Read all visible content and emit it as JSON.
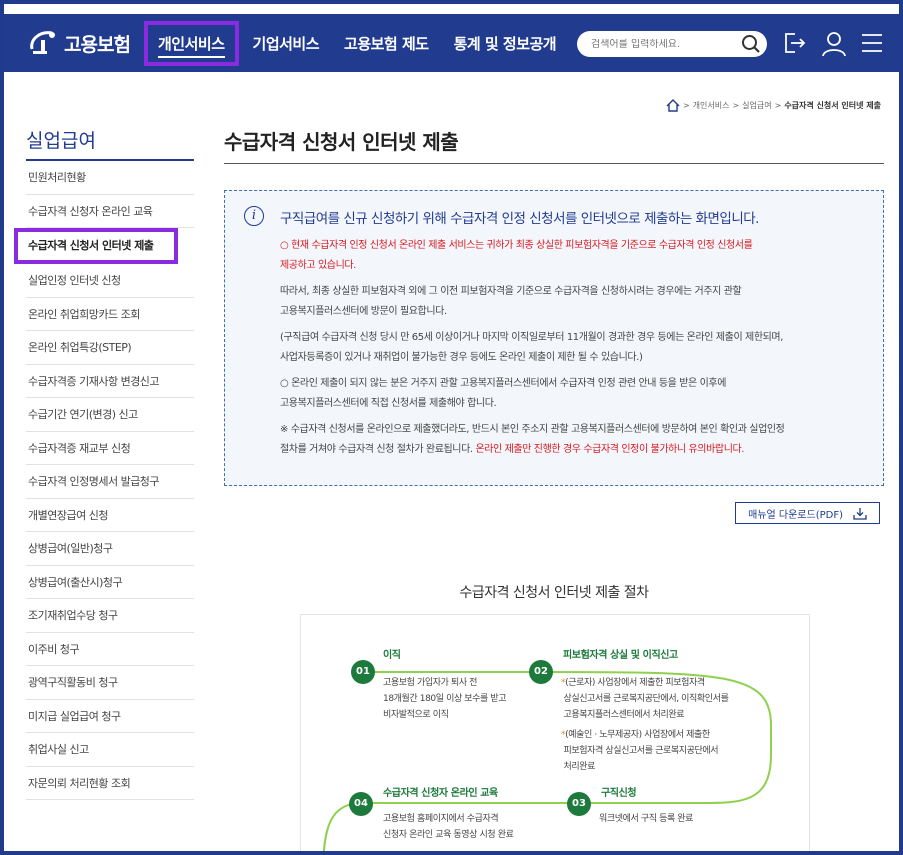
{
  "header": {
    "logo_text": "고용보험",
    "nav": [
      {
        "label": "개인서비스",
        "active": true
      },
      {
        "label": "기업서비스"
      },
      {
        "label": "고용보험 제도"
      },
      {
        "label": "통계 및 정보공개"
      }
    ],
    "search_placeholder": "검색어를 입력하세요.",
    "icons": [
      "search-icon",
      "logout-icon",
      "user-icon",
      "menu-icon"
    ]
  },
  "breadcrumb": {
    "items": [
      "개인서비스",
      "실업급여",
      "수급자격 신청서 인터넷 제출"
    ]
  },
  "sidebar": {
    "title": "실업급여",
    "items": [
      {
        "label": "민원처리현황"
      },
      {
        "label": "수급자격 신청자 온라인 교육"
      },
      {
        "label": "수급자격 신청서 인터넷 제출",
        "active": true
      },
      {
        "label": "실업인정 인터넷 신청"
      },
      {
        "label": "온라인 취업희망카드 조회"
      },
      {
        "label": "온라인 취업특강(STEP)"
      },
      {
        "label": "수급자격증 기재사항 변경신고"
      },
      {
        "label": "수급기간 연기(변경) 신고"
      },
      {
        "label": "수급자격증 재교부 신청"
      },
      {
        "label": "수급자격 인정명세서 발급청구"
      },
      {
        "label": "개별연장급여 신청"
      },
      {
        "label": "상병급여(일반)청구"
      },
      {
        "label": "상병급여(출산시)청구"
      },
      {
        "label": "조기재취업수당 청구"
      },
      {
        "label": "이주비 청구"
      },
      {
        "label": "광역구직활동비 청구"
      },
      {
        "label": "미지급 실업급여 청구"
      },
      {
        "label": "취업사실 신고"
      },
      {
        "label": "자문의뢰 처리현황 조회"
      }
    ]
  },
  "main": {
    "title": "수급자격 신청서 인터넷 제출",
    "info": {
      "heading": "구직급여를 신규 신청하기 위해 수급자격 인정 신청서를 인터넷으로 제출하는 화면입니다.",
      "p1_line1": "○ 현재 수급자격 인정 신청서 온라인 제출 서비스는 귀하가 최종 상실한 피보험자격을 기준으로 수급자격 인정 신청서를",
      "p1_line2": "제공하고 있습니다.",
      "p2_line1": "따라서, 최종 상실한 피보험자격 외에 그 이전 피보험자격을 기준으로 수급자격을 신청하시려는 경우에는 거주지 관할",
      "p2_line2": "고용복지플러스센터에 방문이 필요합니다.",
      "p3_line1": "(구직급여 수급자격 신청 당시 만 65세 이상이거나 마지막 이직일로부터 11개월이 경과한 경우 등에는 온라인 제출이 제한되며,",
      "p3_line2": "사업자등록증이 있거나 재취업이 불가능한 경우 등에도 온라인 제출이 제한 될 수 있습니다.)",
      "p4_line1": "○ 온라인 제출이 되지 않는 분은 거주지 관할 고용복지플러스센터에서 수급자격 인정 관련 안내 등을 받은 이후에",
      "p4_line2": "고용복지플러스센터에 직접 신청서를 제출해야 합니다.",
      "p5_line1": "※ 수급자격 신청서를 온라인으로 제출했더라도, 반드시 본인 주소지 관할 고용복지플러스센터에 방문하여 본인 확인과 실업인정",
      "p5_line2_a": "절차를 거쳐야 수급자격 신청 절차가 완료됩니다. ",
      "p5_line2_b": "온라인 제출만 진행한 경우 수급자격 인정이 불가하니 유의바랍니다."
    },
    "manual_button": "매뉴얼 다운로드(PDF)",
    "process": {
      "title": "수급자격 신청서 인터넷 제출 절차",
      "steps": [
        {
          "num": "01",
          "title": "이직",
          "desc": [
            "고용보험 가입자가 퇴사 전",
            "18개월간 180일 이상 보수를 받고",
            "비자발적으로 이직"
          ]
        },
        {
          "num": "02",
          "title": "피보험자격 상실 및 이직신고",
          "notes": [
            [
              "(근로자) 사업장에서 제출한 피보험자격",
              "상실신고서를 근로복지공단에서, 이직확인서를",
              "고용복지플러스센터에서 처리완료"
            ],
            [
              "(예술인 · 노무제공자) 사업장에서 제출한",
              "피보험자격 상실신고서를 근로복지공단에서",
              "처리완료"
            ]
          ]
        },
        {
          "num": "03",
          "title": "구직신청",
          "desc": [
            "워크넷에서 구직 등록 완료"
          ]
        },
        {
          "num": "04",
          "title": "수급자격 신청자 온라인 교육",
          "desc": [
            "고용보험 홈페이지에서 수급자격",
            "신청자 온라인 교육 동영상 시청 완료"
          ]
        }
      ]
    }
  },
  "colors": {
    "brand": "#213b8f",
    "highlight": "#8a2be2",
    "step_green": "#1e7a3c",
    "line_green": "#8fd14f",
    "warning_red": "#d7191f"
  }
}
